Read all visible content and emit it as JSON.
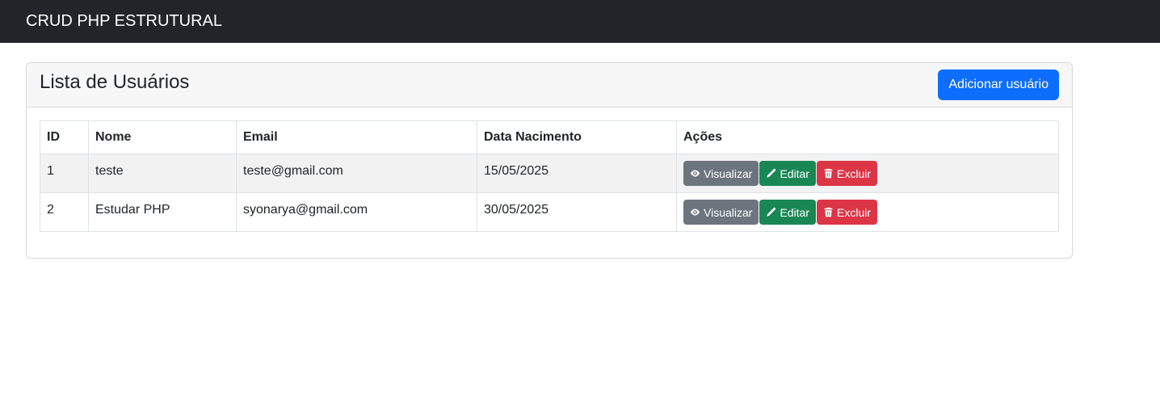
{
  "navbar": {
    "brand": "CRUD PHP ESTRUTURAL"
  },
  "card": {
    "title": "Lista de Usuários",
    "add_button": "Adicionar usuário"
  },
  "table": {
    "headers": [
      "ID",
      "Nome",
      "Email",
      "Data Nacimento",
      "Ações"
    ],
    "rows": [
      {
        "id": "1",
        "nome": "teste",
        "email": "teste@gmail.com",
        "data": "15/05/2025"
      },
      {
        "id": "2",
        "nome": "Estudar PHP",
        "email": "syonarya@gmail.com",
        "data": "30/05/2025"
      }
    ],
    "actions": {
      "view": "Visualizar",
      "edit": "Editar",
      "delete": "Excluir"
    }
  },
  "colors": {
    "navbar": "#212529",
    "primary": "#0d6efd",
    "secondary": "#6c757d",
    "success": "#198754",
    "danger": "#dc3545"
  },
  "icons": {
    "view": "eye-icon",
    "edit": "pencil-icon",
    "delete": "trash-icon"
  }
}
